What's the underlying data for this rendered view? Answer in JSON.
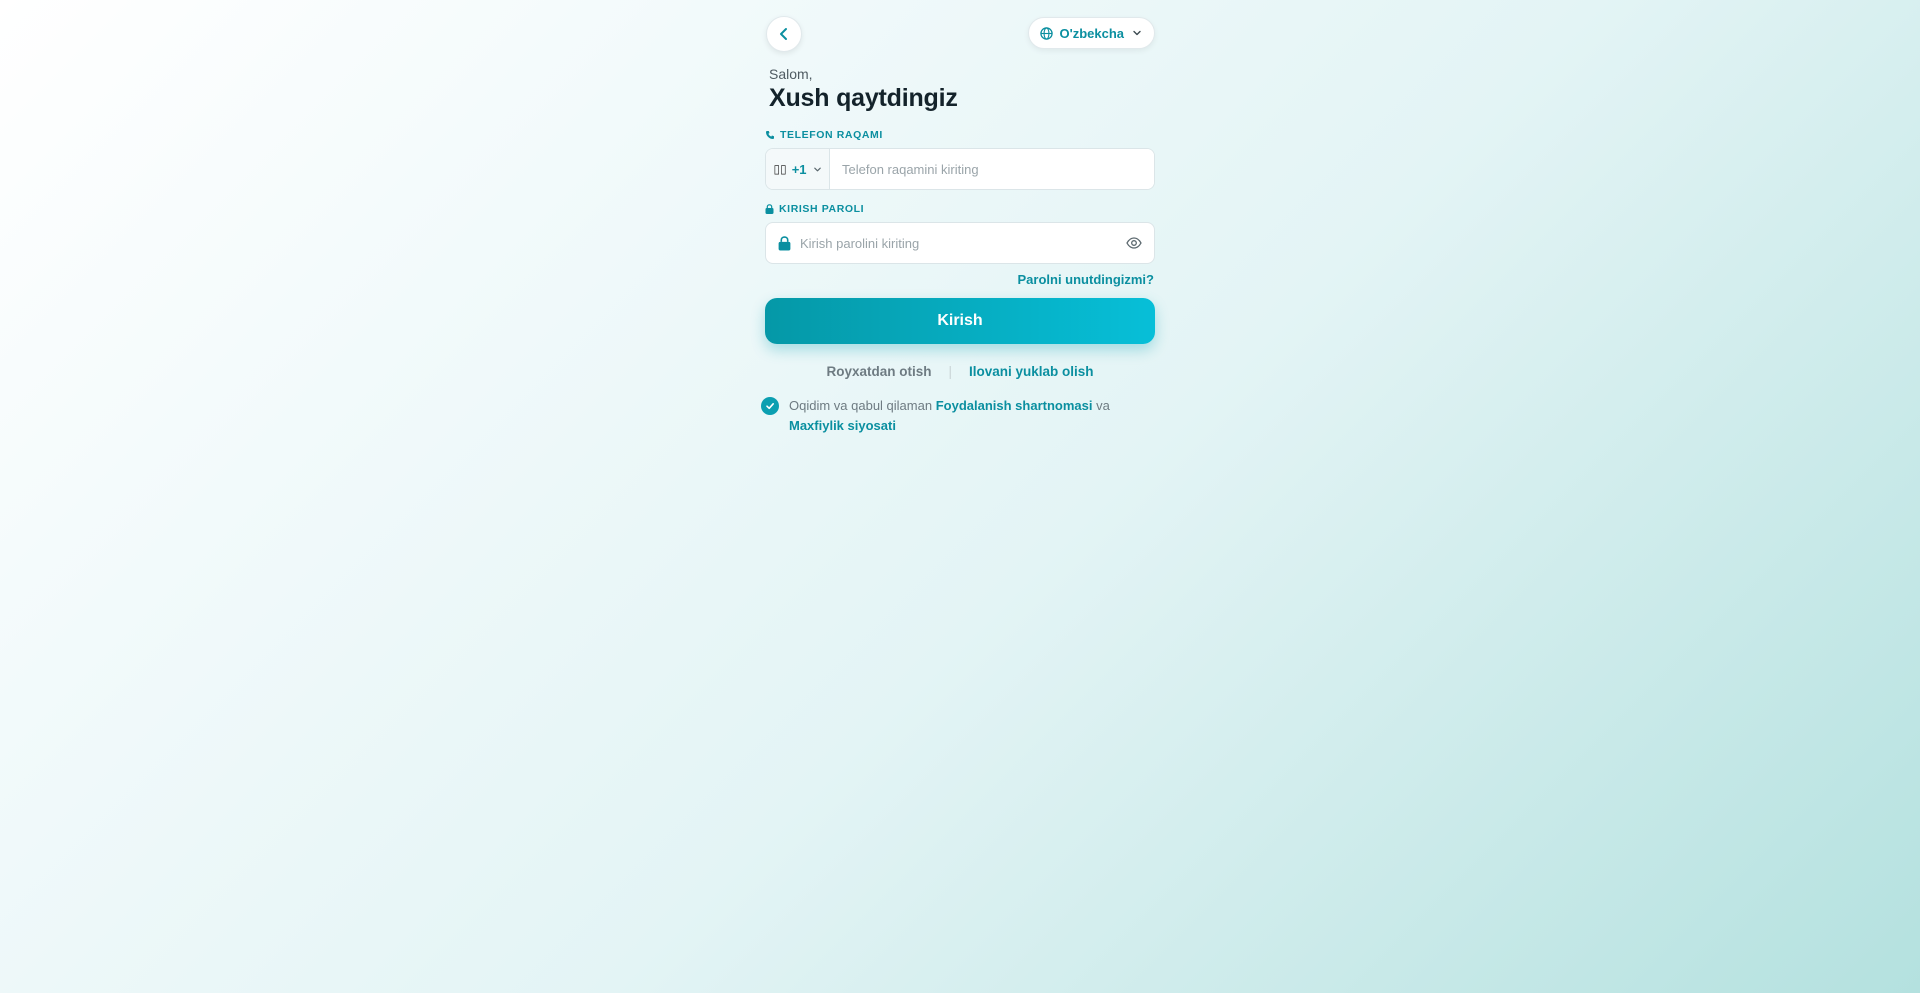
{
  "header": {
    "back_icon": "chevron-left-icon",
    "language": {
      "label": "O'zbekcha",
      "icon": "globe-icon",
      "dropdown_icon": "chevron-down-icon"
    }
  },
  "greeting": "Salom,",
  "title": "Xush qaytdingiz",
  "phone": {
    "label": "TELEFON RAQAMI",
    "label_icon": "phone-icon",
    "country_code": "+1",
    "flag_text": "▯▯",
    "value": "",
    "placeholder": "Telefon raqamini kiriting"
  },
  "password": {
    "label": "KIRISH PAROLI",
    "label_icon": "lock-icon",
    "value": "",
    "placeholder": "Kirish parolini kiriting",
    "toggle_icon": "eye-icon"
  },
  "forgot_password": "Parolni unutdingizmi?",
  "submit_label": "Kirish",
  "links": {
    "register": "Royxatdan otish",
    "separator": "|",
    "download_app": "Ilovani yuklab olish"
  },
  "terms": {
    "checked": true,
    "prefix": "Oqidim va qabul qilaman",
    "terms_link": "Foydalanish shartnomasi",
    "conjunction": "va",
    "privacy_link": "Maxfiylik siyosati"
  },
  "colors": {
    "accent": "#0b8fa0",
    "button_start": "#0598a7",
    "button_end": "#07bfd8",
    "title": "#14232b"
  }
}
